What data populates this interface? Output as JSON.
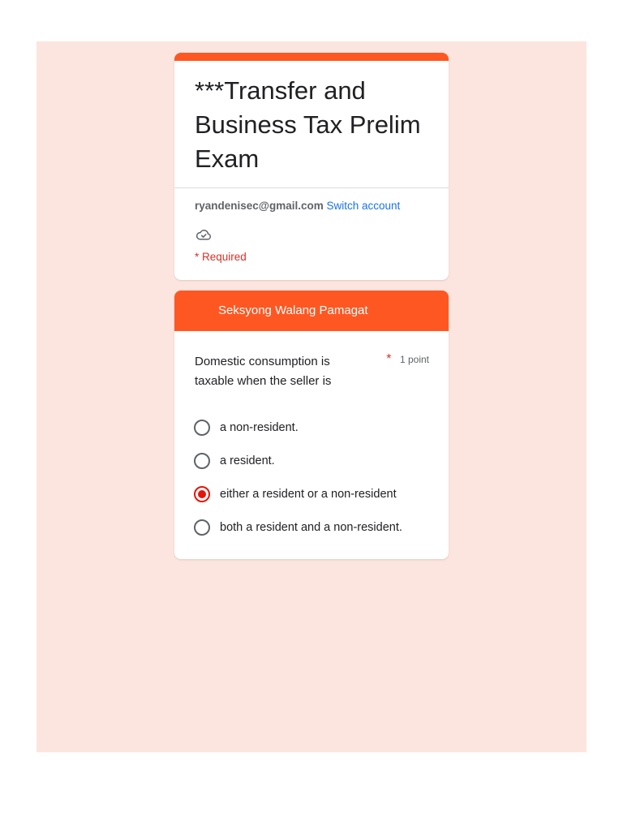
{
  "form": {
    "title": "***Transfer and Business Tax Prelim Exam",
    "account_email": "ryandenisec@gmail.com",
    "switch_account_label": "Switch account",
    "save_status_icon": "cloud-check-icon",
    "required_note": "* Required"
  },
  "section": {
    "title": "Seksyong Walang Pamagat",
    "question": {
      "text": "Domestic consumption is taxable when the seller is",
      "required_marker": "*",
      "points": "1 point",
      "options": [
        {
          "label": "a non-resident.",
          "selected": false
        },
        {
          "label": "a resident.",
          "selected": false
        },
        {
          "label": "either a resident or a non-resident",
          "selected": true
        },
        {
          "label": "both a resident and a non-resident.",
          "selected": false
        }
      ]
    }
  },
  "colors": {
    "accent": "#ff5722",
    "background": "#fde5df",
    "link": "#1a73e8",
    "required": "#d93025",
    "radio_selected": "#e8140a"
  }
}
